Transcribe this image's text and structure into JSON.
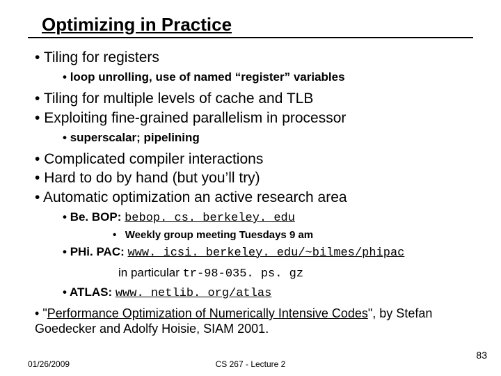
{
  "title": "Optimizing in Practice",
  "b1": "Tiling for registers",
  "b1_1": "loop unrolling, use of named “register” variables",
  "b2": "Tiling for multiple levels of cache and TLB",
  "b3": "Exploiting fine-grained parallelism in processor",
  "b3_1": "superscalar; pipelining",
  "b4": "Complicated compiler interactions",
  "b5": "Hard to do by hand (but you’ll try)",
  "b6": "Automatic optimization an active research area",
  "b6_1_label": "Be. BOP: ",
  "b6_1_url": "bebop. cs. berkeley. edu",
  "b6_1_1": "Weekly group meeting Tuesdays 9 am",
  "b6_2_label": "PHi. PAC: ",
  "b6_2_url": "www. icsi. berkeley. edu/~bilmes/phipac",
  "b6_2_extra_pre": "in particular ",
  "b6_2_extra_code": "tr-98-035. ps. gz",
  "b6_3_label": "ATLAS: ",
  "b6_3_url": "www. netlib. org/atlas",
  "b7_pre": "\"",
  "b7_link": "Performance Optimization of Numerically Intensive Codes",
  "b7_post": "\", by Stefan Goedecker and Adolfy Hoisie, SIAM 2001.",
  "footer_date": "01/26/2009",
  "footer_center": "CS 267 - Lecture 2",
  "footer_page": "83"
}
